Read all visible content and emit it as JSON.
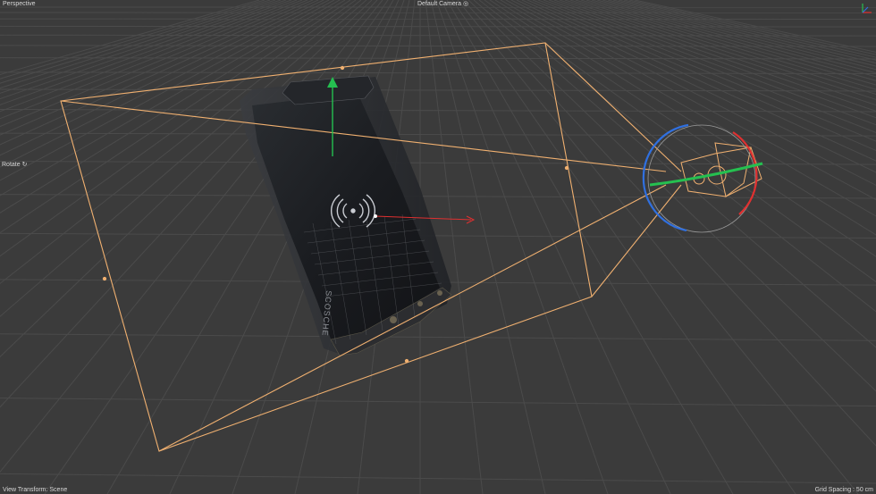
{
  "viewport": {
    "view_label": "Perspective",
    "camera_label": "Default Camera",
    "camera_icon": "camera-icon",
    "tool_label": "Rotate",
    "tool_icon": "rotate-icon",
    "transform_label": "View Transform: Scene",
    "grid_label": "Grid Spacing : 50 cm"
  },
  "phone": {
    "brand_text": "SCOSCHE"
  },
  "colors": {
    "background": "#3b3b3b",
    "grid": "#4a4a4a",
    "camera_frustum": "#f0b070",
    "axis_x": "#e03030",
    "axis_y": "#25c050",
    "axis_z": "#3070e0"
  }
}
